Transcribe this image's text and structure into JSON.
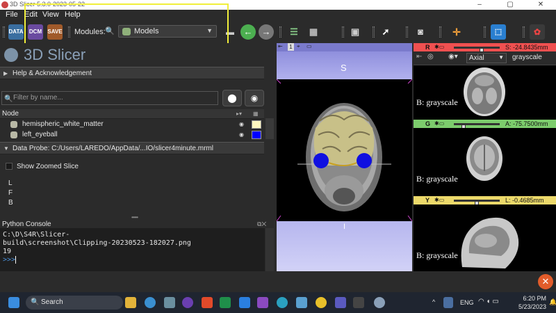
{
  "window": {
    "title": "3D Slicer 5.3.0-2023-05-22",
    "controls": [
      "–",
      "▢",
      "✕"
    ]
  },
  "menu": {
    "items": [
      "File",
      "Edit",
      "View",
      "Help"
    ]
  },
  "toolbar": {
    "data_label": "DATA",
    "dcm_label": "DCM",
    "save_label": "SAVE",
    "modules_label": "Modules:",
    "module_selected": "Models",
    "accent_highlight": "#f0ee3a"
  },
  "left_panel": {
    "logo_text": "3D Slicer",
    "help_section": "Help & Acknowledgement",
    "filter_placeholder": "Filter by name...",
    "tree_header": "Node",
    "tree_rows": [
      {
        "label": "hemispheric_white_matter",
        "swatch": "#fff8c0"
      },
      {
        "label": "left_eyeball",
        "swatch": "#0000ff"
      }
    ],
    "probe_section": "Data Probe: C:/Users/LAREDO/AppData/...IO/slicer4minute.mrml",
    "show_zoomed_slice": "Show Zoomed Slice",
    "probe_rows": [
      "L",
      "F",
      "B"
    ]
  },
  "python_console": {
    "title": "Python Console",
    "lines": [
      "C:\\D\\S4R\\Slicer-",
      "build\\screenshot\\Clipping-20230523-182027.png",
      "19"
    ],
    "prompt": ">>>"
  },
  "view3d": {
    "view_number": "1",
    "top_orientation": "S",
    "bottom_orientation": "I"
  },
  "slice_views": [
    {
      "letter": "R",
      "offset": "S: -24.8435mm",
      "color": "#f05050",
      "orientation": "Axial",
      "volume": "grayscale",
      "label": "B: grayscale",
      "knob_pct": 0.62
    },
    {
      "letter": "G",
      "offset": "A: -75.7500mm",
      "color": "#7ccc6c",
      "label": "B: grayscale",
      "knob_pct": 0.18
    },
    {
      "letter": "Y",
      "offset": "L: -0.4685mm",
      "color": "#ecd96a",
      "label": "B: grayscale",
      "knob_pct": 0.5
    }
  ],
  "taskbar": {
    "search_label": "Search",
    "language": "ENG",
    "time": "6:20 PM",
    "date": "5/23/2023"
  }
}
